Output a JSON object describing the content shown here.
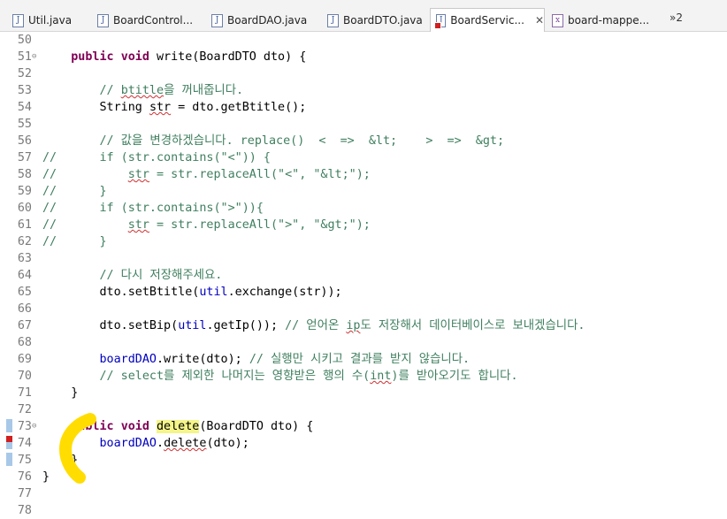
{
  "tabs": [
    {
      "label": "Util.java",
      "icon": "java-file-icon"
    },
    {
      "label": "BoardControl...",
      "icon": "java-file-icon"
    },
    {
      "label": "BoardDAO.java",
      "icon": "java-file-icon"
    },
    {
      "label": "BoardDTO.java",
      "icon": "java-file-icon"
    },
    {
      "label": "BoardServic...",
      "icon": "java-file-error-icon",
      "active": true,
      "close": "✕"
    },
    {
      "label": "board-mappe...",
      "icon": "xml-file-icon"
    }
  ],
  "tab_overflow": "»2",
  "colors": {
    "keyword": "#7f0055",
    "comment": "#3f7f5f",
    "string": "#2a00ff",
    "field": "#0000c0",
    "annotation": "#ffdd00",
    "search_highlight": "#f5f58a"
  },
  "lines": [
    {
      "n": "50",
      "t": [
        {
          "s": ""
        }
      ]
    },
    {
      "n": "51",
      "fold": "⊖",
      "t": [
        {
          "s": "    "
        },
        {
          "s": "public",
          "c": "kw"
        },
        {
          "s": " "
        },
        {
          "s": "void",
          "c": "kw"
        },
        {
          "s": " write(BoardDTO dto) {"
        }
      ]
    },
    {
      "n": "52",
      "t": [
        {
          "s": ""
        }
      ]
    },
    {
      "n": "53",
      "t": [
        {
          "s": "        "
        },
        {
          "s": "// ",
          "c": "cm"
        },
        {
          "s": "btitle",
          "c": "cm sq"
        },
        {
          "s": "을 꺼내줍니다.",
          "c": "cm"
        }
      ]
    },
    {
      "n": "54",
      "t": [
        {
          "s": "        String "
        },
        {
          "s": "str",
          "c": "sq"
        },
        {
          "s": " = dto.getBtitle();"
        }
      ]
    },
    {
      "n": "55",
      "t": [
        {
          "s": ""
        }
      ]
    },
    {
      "n": "56",
      "t": [
        {
          "s": "        "
        },
        {
          "s": "// 값을 변경하겠습니다. replace()  <  =>  &lt;    >  =>  &gt;",
          "c": "cm"
        }
      ]
    },
    {
      "n": "57",
      "t": [
        {
          "s": "//",
          "c": "cm"
        },
        {
          "s": "      if (str.contains(\"<\")) {",
          "c": "cm"
        }
      ]
    },
    {
      "n": "58",
      "t": [
        {
          "s": "//",
          "c": "cm"
        },
        {
          "s": "          ",
          "c": "cm"
        },
        {
          "s": "str",
          "c": "cm sq"
        },
        {
          "s": " = str.replaceAll(\"<\", \"&lt;\");",
          "c": "cm"
        }
      ]
    },
    {
      "n": "59",
      "t": [
        {
          "s": "//",
          "c": "cm"
        },
        {
          "s": "      }",
          "c": "cm"
        }
      ]
    },
    {
      "n": "60",
      "t": [
        {
          "s": "//",
          "c": "cm"
        },
        {
          "s": "      if (str.contains(\">\")){",
          "c": "cm"
        }
      ]
    },
    {
      "n": "61",
      "t": [
        {
          "s": "//",
          "c": "cm"
        },
        {
          "s": "          ",
          "c": "cm"
        },
        {
          "s": "str",
          "c": "cm sq"
        },
        {
          "s": " = str.replaceAll(\">\", \"&gt;\");",
          "c": "cm"
        }
      ]
    },
    {
      "n": "62",
      "t": [
        {
          "s": "//",
          "c": "cm"
        },
        {
          "s": "      }",
          "c": "cm"
        }
      ]
    },
    {
      "n": "63",
      "t": [
        {
          "s": ""
        }
      ]
    },
    {
      "n": "64",
      "t": [
        {
          "s": "        "
        },
        {
          "s": "// 다시 저장해주세요.",
          "c": "cm"
        }
      ]
    },
    {
      "n": "65",
      "t": [
        {
          "s": "        dto.setBtitle("
        },
        {
          "s": "util",
          "c": "fd"
        },
        {
          "s": ".exchange(str));"
        }
      ]
    },
    {
      "n": "66",
      "t": [
        {
          "s": ""
        }
      ]
    },
    {
      "n": "67",
      "t": [
        {
          "s": "        dto.setBip("
        },
        {
          "s": "util",
          "c": "fd"
        },
        {
          "s": ".getIp()); "
        },
        {
          "s": "// 얻어온 ",
          "c": "cm"
        },
        {
          "s": "ip",
          "c": "cm sq"
        },
        {
          "s": "도 저장해서 데이터베이스로 보내겠습니다.",
          "c": "cm"
        }
      ]
    },
    {
      "n": "68",
      "t": [
        {
          "s": ""
        }
      ]
    },
    {
      "n": "69",
      "t": [
        {
          "s": "        "
        },
        {
          "s": "boardDAO",
          "c": "fd"
        },
        {
          "s": ".write(dto); "
        },
        {
          "s": "// 실행만 시키고 결과를 받지 않습니다.",
          "c": "cm"
        }
      ]
    },
    {
      "n": "70",
      "t": [
        {
          "s": "        "
        },
        {
          "s": "// select를 제외한 나머지는 영향받은 행의 수(",
          "c": "cm"
        },
        {
          "s": "int",
          "c": "cm sq"
        },
        {
          "s": ")를 받아오기도 합니다.",
          "c": "cm"
        }
      ]
    },
    {
      "n": "71",
      "t": [
        {
          "s": "    }"
        }
      ]
    },
    {
      "n": "72",
      "t": [
        {
          "s": ""
        }
      ]
    },
    {
      "n": "73",
      "fold": "⊖",
      "t": [
        {
          "s": "    "
        },
        {
          "s": "public",
          "c": "kw"
        },
        {
          "s": " "
        },
        {
          "s": "void",
          "c": "kw"
        },
        {
          "s": " "
        },
        {
          "s": "delete",
          "c": "hl"
        },
        {
          "s": "(BoardDTO dto) {"
        }
      ]
    },
    {
      "n": "74",
      "t": [
        {
          "s": "        "
        },
        {
          "s": "boardDAO",
          "c": "fd"
        },
        {
          "s": "."
        },
        {
          "s": "delete",
          "c": "sq"
        },
        {
          "s": "(dto);"
        }
      ]
    },
    {
      "n": "75",
      "t": [
        {
          "s": "    }"
        }
      ]
    },
    {
      "n": "76",
      "t": [
        {
          "s": "}"
        }
      ]
    },
    {
      "n": "77",
      "t": [
        {
          "s": ""
        }
      ]
    },
    {
      "n": "78",
      "t": [
        {
          "s": ""
        }
      ]
    }
  ]
}
